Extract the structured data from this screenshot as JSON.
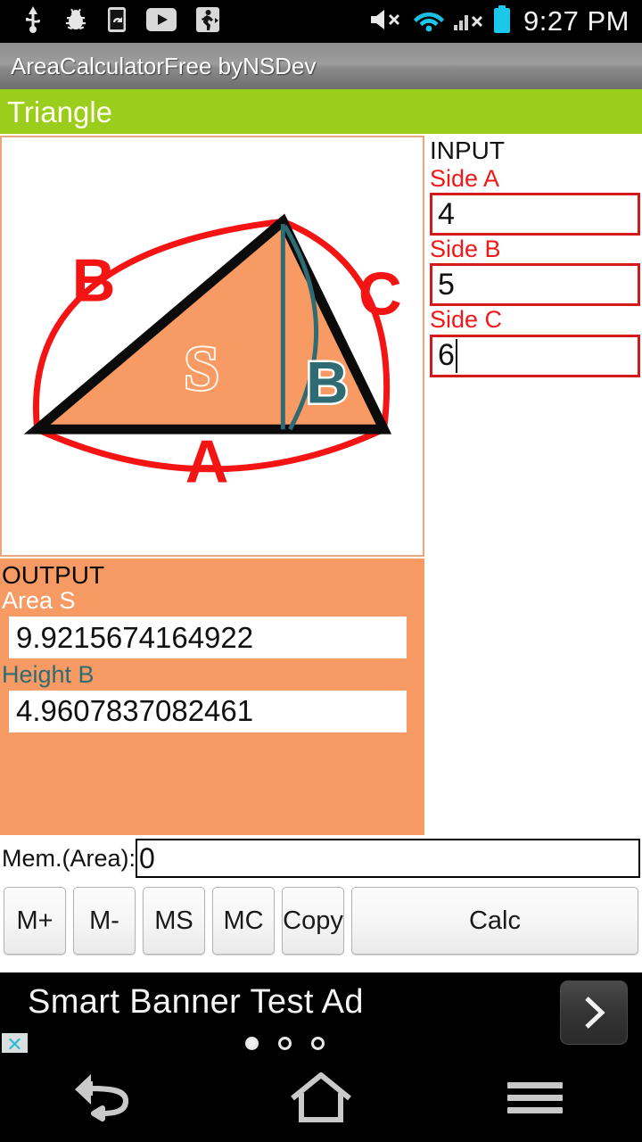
{
  "statusbar": {
    "left_icons": [
      "usb-icon",
      "bug-icon",
      "screen-rotate-icon",
      "youtube-icon",
      "running-person-icon"
    ],
    "right_icons": [
      "volume-mute-icon",
      "wifi-icon",
      "cellular-signal-off-icon",
      "battery-icon"
    ],
    "time": "9:27 PM"
  },
  "titlebar": {
    "app_title": "AreaCalculatorFree byNSDev"
  },
  "section": {
    "shape_title": "Triangle"
  },
  "figure": {
    "label_a": "A",
    "label_b": "B",
    "label_c": "C",
    "label_area": "S",
    "label_height": "B",
    "fill_color": "#F79A63",
    "outline_color": "#0B0B0B",
    "arc_color": "#F41414",
    "height_color": "#2E6B72"
  },
  "input": {
    "heading": "INPUT",
    "fields": [
      {
        "label": "Side A",
        "value": "4"
      },
      {
        "label": "Side B",
        "value": "5"
      },
      {
        "label": "Side C",
        "value": "6"
      }
    ]
  },
  "output": {
    "heading": "OUTPUT",
    "fields": [
      {
        "label": "Area S",
        "value": "9.9215674164922"
      },
      {
        "label": "Height B",
        "value": "4.9607837082461"
      }
    ]
  },
  "memory": {
    "label": "Mem.(Area):",
    "value": "0"
  },
  "buttons": [
    {
      "label": "M+",
      "name": "memory-add-button"
    },
    {
      "label": "M-",
      "name": "memory-subtract-button"
    },
    {
      "label": "MS",
      "name": "memory-store-button"
    },
    {
      "label": "MC",
      "name": "memory-clear-button"
    },
    {
      "label": "Copy",
      "name": "copy-button"
    },
    {
      "label": "Calc",
      "name": "calc-button"
    }
  ],
  "ad": {
    "text": "Smart Banner Test Ad",
    "close_label": "✕",
    "arrow_label": "❯"
  },
  "navbar": {
    "items": [
      "back-icon",
      "home-icon",
      "menu-icon"
    ]
  },
  "colors": {
    "green_bar": "#9ACD1C",
    "orange_panel": "#F79A63",
    "input_border_red": "#D31919",
    "label_red": "#F01818",
    "teal": "#2E6B72"
  }
}
